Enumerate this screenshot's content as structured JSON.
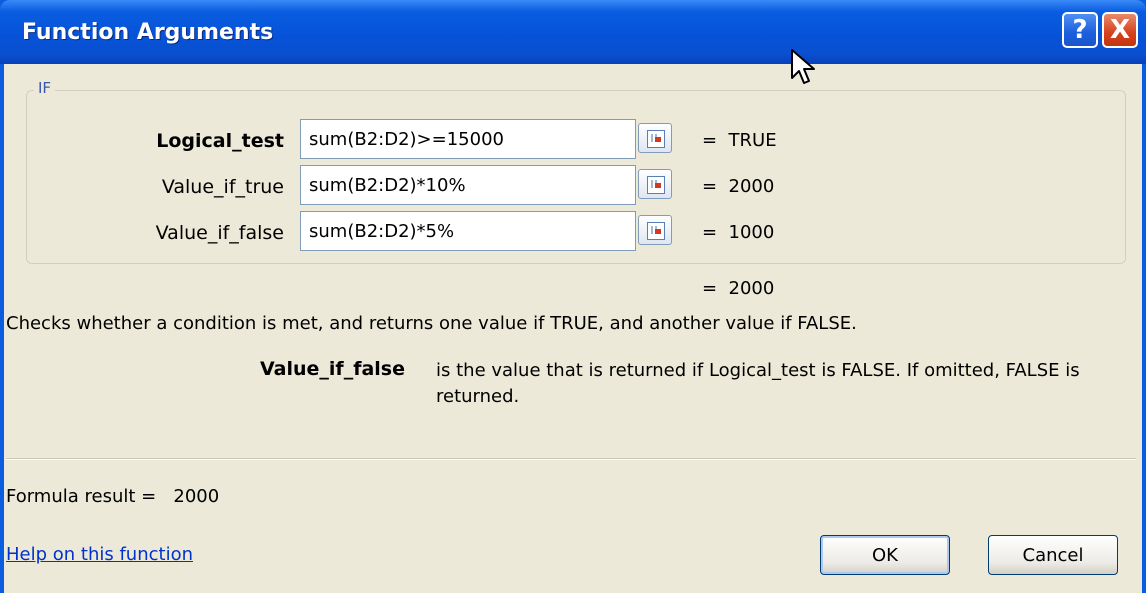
{
  "window": {
    "title": "Function Arguments",
    "help_button": "?",
    "close_button": "X"
  },
  "group": {
    "label": "IF"
  },
  "arguments": [
    {
      "label": "Logical_test",
      "value": "sum(B2:D2)>=15000",
      "result": "=  TRUE"
    },
    {
      "label": "Value_if_true",
      "value": "sum(B2:D2)*10%",
      "result": "=  2000"
    },
    {
      "label": "Value_if_false",
      "value": "sum(B2:D2)*5%",
      "result": "=  1000"
    }
  ],
  "function_result": "=  2000",
  "description": "Checks whether a condition is met, and returns one value if TRUE, and another value if FALSE.",
  "argument_help": {
    "name": "Value_if_false",
    "text": "is the value that is returned if Logical_test is FALSE. If omitted, FALSE is returned."
  },
  "formula_result": "Formula result =   2000",
  "help_link": "Help on this function",
  "buttons": {
    "ok": "OK",
    "cancel": "Cancel"
  },
  "icons": {
    "ref": "range-select-icon",
    "cursor": "mouse-pointer-icon"
  }
}
